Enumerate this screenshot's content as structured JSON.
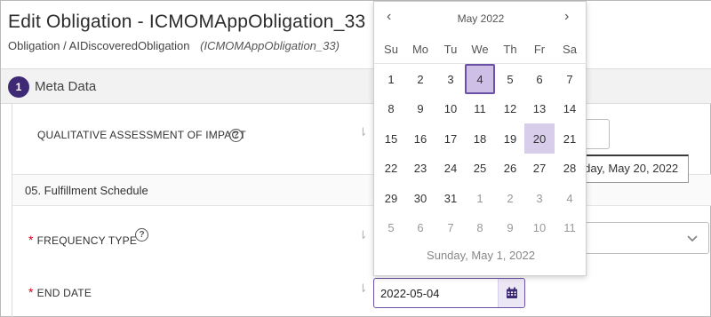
{
  "header": {
    "title": "Edit Obligation - ICMOMAppObligation_33",
    "breadcrumb_path": "Obligation / AIDiscoveredObligation",
    "breadcrumb_id": "(ICMOMAppObligation_33)"
  },
  "section": {
    "step_number": "1",
    "label": "Meta Data"
  },
  "fields": {
    "qualitative": {
      "label": "QUALITATIVE ASSESSMENT OF IMPACT",
      "help": "?"
    },
    "subheading": "05. Fulfillment Schedule",
    "frequency_type": {
      "required": "*",
      "label": "FREQUENCY TYPE",
      "help": "?"
    },
    "end_date": {
      "required": "*",
      "label": "END DATE",
      "value": "2022-05-04"
    }
  },
  "tooltip": "Friday, May 20, 2022",
  "calendar": {
    "month_label": "May 2022",
    "prev": "‹",
    "next": "›",
    "weekdays": [
      "Su",
      "Mo",
      "Tu",
      "We",
      "Th",
      "Fr",
      "Sa"
    ],
    "weeks": [
      [
        "1",
        "2",
        "3",
        "4",
        "5",
        "6",
        "7"
      ],
      [
        "8",
        "9",
        "10",
        "11",
        "12",
        "13",
        "14"
      ],
      [
        "15",
        "16",
        "17",
        "18",
        "19",
        "20",
        "21"
      ],
      [
        "22",
        "23",
        "24",
        "25",
        "26",
        "27",
        "28"
      ],
      [
        "29",
        "30",
        "31",
        "1",
        "2",
        "3",
        "4"
      ],
      [
        "5",
        "6",
        "7",
        "8",
        "9",
        "10",
        "11"
      ]
    ],
    "footer": "Sunday, May 1, 2022",
    "selected_day": "4",
    "hovered_day": "20"
  },
  "icons": {
    "sort": "sort-icon",
    "calendar": "calendar-icon",
    "chevron": "chevron-down-icon"
  },
  "colors": {
    "accent": "#3e2a74",
    "selected_fill": "#cdbfe6",
    "hover_fill": "#d9cdec"
  }
}
